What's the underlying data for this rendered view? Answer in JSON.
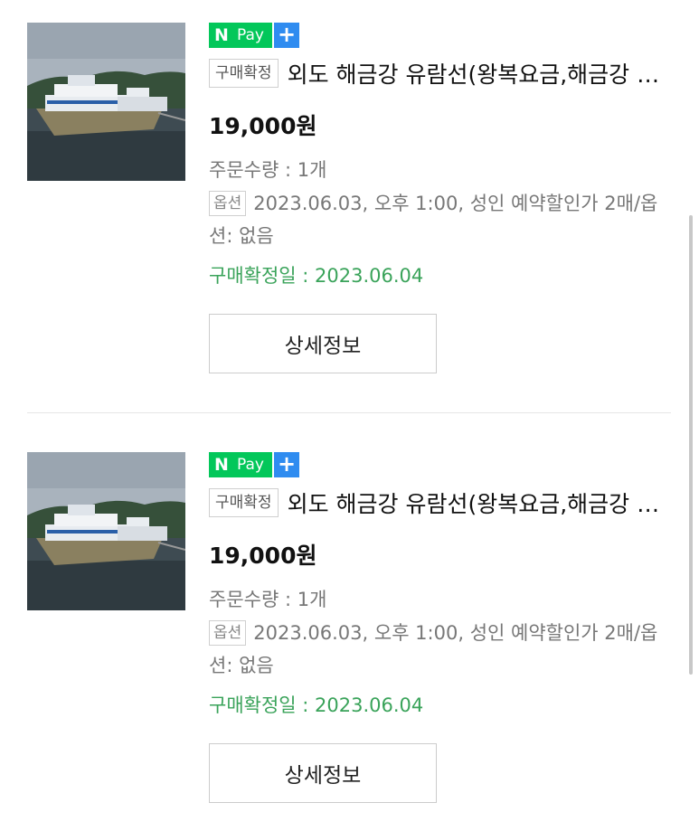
{
  "orders": [
    {
      "npay": {
        "n": "N",
        "pay": "Pay",
        "plus": "+"
      },
      "status_badge": "구매확정",
      "title": "외도 해금강 유람선(왕복요금,해금강 유람선 선착장)",
      "price": "19,000원",
      "quantity": "주문수량 : 1개",
      "option_badge": "옵션",
      "option_text": "2023.06.03, 오후 1:00, 성인 예약할인가 2매/옵션: 없음",
      "confirm_date": "구매확정일 : 2023.06.04",
      "detail_button": "상세정보"
    },
    {
      "npay": {
        "n": "N",
        "pay": "Pay",
        "plus": "+"
      },
      "status_badge": "구매확정",
      "title": "외도 해금강 유람선(왕복요금,해금강 유람선 선착장)",
      "price": "19,000원",
      "quantity": "주문수량 : 1개",
      "option_badge": "옵션",
      "option_text": "2023.06.03, 오후 1:00, 성인 예약할인가 2매/옵션: 없음",
      "confirm_date": "구매확정일 : 2023.06.04",
      "detail_button": "상세정보"
    }
  ],
  "colors": {
    "npay_green": "#03c75a",
    "plus_blue": "#2f8cf0",
    "confirm_green": "#3aa35a"
  },
  "thumbnail_icon": "ferry-boat-photo"
}
